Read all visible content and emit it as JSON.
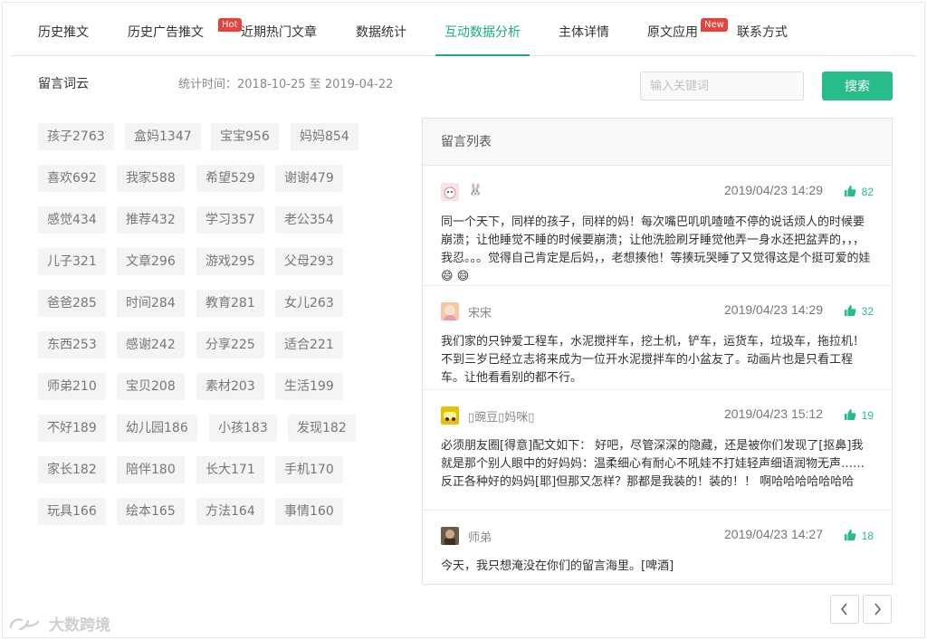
{
  "tabs": [
    {
      "label": "历史推文",
      "badge": ""
    },
    {
      "label": "历史广告推文",
      "badge": "Hot"
    },
    {
      "label": "近期热门文章",
      "badge": ""
    },
    {
      "label": "数据统计",
      "badge": ""
    },
    {
      "label": "互动数据分析",
      "badge": ""
    },
    {
      "label": "主体详情",
      "badge": ""
    },
    {
      "label": "原文应用",
      "badge": "New"
    },
    {
      "label": "联系方式",
      "badge": ""
    }
  ],
  "active_tab": "互动数据分析",
  "section": {
    "title": "留言词云",
    "stat_time": "统计时间：2018-10-25 至 2019-04-22"
  },
  "search": {
    "placeholder": "输入关键词",
    "value": "",
    "button_label": "搜索"
  },
  "word_cloud": [
    "孩子2763",
    "盒妈1347",
    "宝宝956",
    "妈妈854",
    "喜欢692",
    "我家588",
    "希望529",
    "谢谢479",
    "感觉434",
    "推荐432",
    "学习357",
    "老公354",
    "儿子321",
    "文章296",
    "游戏295",
    "父母293",
    "爸爸285",
    "时间284",
    "教育281",
    "女儿263",
    "东西253",
    "感谢242",
    "分享225",
    "适合221",
    "师弟210",
    "宝贝208",
    "素材203",
    "生活199",
    "不好189",
    "幼儿园186",
    "小孩183",
    "发现182",
    "家长182",
    "陪伴180",
    "长大171",
    "手机170",
    "玩具166",
    "绘本165",
    "方法164",
    "事情160"
  ],
  "comment_list": {
    "title": "留言列表",
    "items": [
      {
        "nick": "🐰",
        "date": "2019/04/23 14:29",
        "likes": "82",
        "text": "同一个天下，同样的孩子，同样的妈！每次嘴巴叽叽喳喳不停的说话烦人的时候要崩溃；让他睡觉不睡的时候要崩溃；让他洗脸刷牙睡觉他弄一身水还把盆弄的，，，我忍。。。觉得自己肯定是后妈，，老想揍他！等揍玩哭睡了又觉得这是个挺可爱的娃😄 😄"
      },
      {
        "nick": "宋宋",
        "date": "2019/04/23 14:29",
        "likes": "32",
        "text": "我们家的只钟爱工程车，水泥搅拌车，挖土机，铲车，运货车，垃圾车，拖拉机！不到三岁已经立志将来成为一位开水泥搅拌车的小盆友了。动画片也是只看工程车。让他看看别的都不行。"
      },
      {
        "nick": "▯豌豆▯妈咪▯",
        "date": "2019/04/23 15:12",
        "likes": "19",
        "text": "必须朋友圈[得意]配文如下： 好吧，尽管深深的隐藏，还是被你们发现了[抠鼻]我就是那个别人眼中的好妈妈：温柔细心有耐心不吼娃不打娃轻声细语润物无声……反正各种好的妈妈[耶]但那又怎样？那都是我装的！装的！！ 啊哈哈哈哈哈哈哈"
      },
      {
        "nick": "师弟",
        "date": "2019/04/23 14:27",
        "likes": "18",
        "text": "今天，我只想淹没在你们的留言海里。[啤酒]"
      }
    ]
  },
  "watermark": "大数跨境",
  "colors": {
    "accent": "#1aad7a",
    "button": "#28bd88",
    "badge": "#e64340",
    "tag_bg": "#f4f4f4"
  },
  "icons": {
    "like": "thumbs-up-icon",
    "prev": "chevron-left-icon",
    "next": "chevron-right-icon"
  }
}
